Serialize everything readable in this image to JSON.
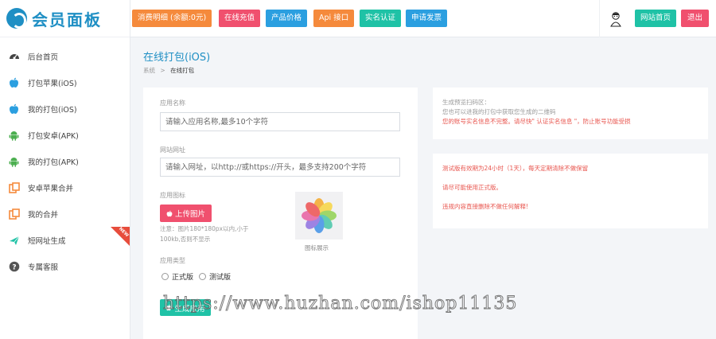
{
  "logo": {
    "text": "会员面板"
  },
  "sidebar": {
    "items": [
      {
        "label": "后台首页",
        "icon": "dashboard-icon",
        "new": false
      },
      {
        "label": "打包苹果(iOS)",
        "icon": "apple-icon",
        "new": false
      },
      {
        "label": "我的打包(iOS)",
        "icon": "apple-icon",
        "new": false
      },
      {
        "label": "打包安卓(APK)",
        "icon": "android-icon",
        "new": false
      },
      {
        "label": "我的打包(APK)",
        "icon": "android-icon",
        "new": false
      },
      {
        "label": "安卓苹果合并",
        "icon": "copy-icon",
        "new": false
      },
      {
        "label": "我的合并",
        "icon": "copy-icon",
        "new": false
      },
      {
        "label": "短网址生成",
        "icon": "plane-icon",
        "new": true,
        "badge": "NEW"
      },
      {
        "label": "专属客服",
        "icon": "question-icon",
        "new": false
      }
    ]
  },
  "topbar": {
    "buttons": [
      {
        "label": "消费明细 (余额:0元)",
        "color": "#f58a3c"
      },
      {
        "label": "在线充值",
        "color": "#f0506e"
      },
      {
        "label": "产品价格",
        "color": "#2b9fe0"
      },
      {
        "label": "Api 接口",
        "color": "#f58a3c"
      },
      {
        "label": "实名认证",
        "color": "#1fc2a6"
      },
      {
        "label": "申请发票",
        "color": "#2b9fe0"
      }
    ],
    "home_label": "网站首页",
    "logout_label": "退出"
  },
  "page": {
    "title": "在线打包(iOS)",
    "breadcrumb_root": "系统",
    "breadcrumb_current": "在线打包"
  },
  "form": {
    "app_name_label": "应用名称",
    "app_name_placeholder": "请输入应用名称,最多10个字符",
    "url_label": "网站网址",
    "url_placeholder": "请输入网址，以http://或https://开头，最多支持200个字符",
    "icon_label": "应用图标",
    "upload_label": "上传图片",
    "note": "注意：图片180*180px以内,小于100kb,否则不显示",
    "preview_caption": "图标展示",
    "type_label": "应用类型",
    "type_options": [
      "正式版",
      "测试版"
    ],
    "submit_label": "生成应用"
  },
  "preview_panel": {
    "title": "生成预览扫码区：",
    "line1": "您也可以进我的打包中获取您生成的二维码",
    "warning": "您的账号实名信息不完整。请尽快\" 认证实名信息 \"，防止账号功能受损"
  },
  "notice_panel": {
    "lines": [
      "测试版有效期为24小时（1天），每天定期清除不做保留",
      "请尽可能使用正式版。",
      "违规内容直接删除不做任何解释!"
    ]
  },
  "watermark": "https://www.huzhan.com/ishop11135",
  "colors": {
    "accent": "#1f8fc4",
    "danger": "#e8554e",
    "teal": "#1fc2a6"
  }
}
